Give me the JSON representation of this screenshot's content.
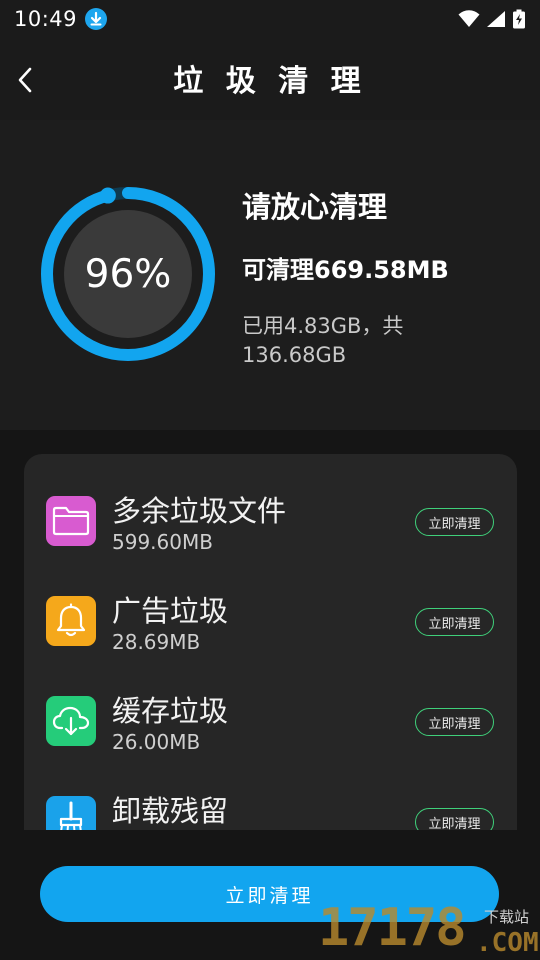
{
  "status_bar": {
    "time": "10:49",
    "icons": [
      "download-icon",
      "wifi-icon",
      "signal-icon",
      "battery-charging-icon"
    ]
  },
  "header": {
    "title": "垃 圾 清 理",
    "back_icon": "chevron-left-icon"
  },
  "summary": {
    "percent": 96,
    "percent_label": "96%",
    "heading": "请放心清理",
    "cleanable": "可清理669.58MB",
    "usage": "已用4.83GB，共136.68GB",
    "ring_color": "#12a5ef"
  },
  "junk_items": [
    {
      "name": "多余垃圾文件",
      "size": "599.60MB",
      "button": "立即清理",
      "icon": "folder-icon",
      "color": "#d85bd0"
    },
    {
      "name": "广告垃圾",
      "size": "28.69MB",
      "button": "立即清理",
      "icon": "bell-icon",
      "color": "#f5a81b"
    },
    {
      "name": "缓存垃圾",
      "size": "26.00MB",
      "button": "立即清理",
      "icon": "cloud-download-icon",
      "color": "#25cc7a"
    },
    {
      "name": "卸载残留",
      "size": "",
      "button": "立即清理",
      "icon": "brush-icon",
      "color": "#1aa2ea"
    }
  ],
  "action": {
    "clean_label": "立即清理",
    "color": "#12a5ef"
  },
  "watermark": {
    "digits": "17178",
    "site": "下载站",
    "domain": ".COM"
  }
}
